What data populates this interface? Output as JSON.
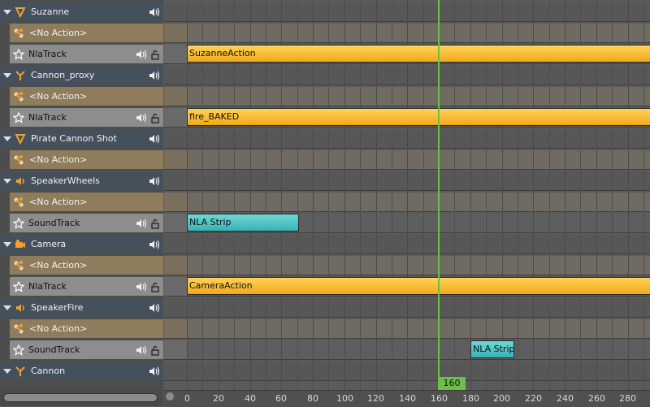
{
  "channels": [
    {
      "kind": "object",
      "label": "Suzanne",
      "icon": "triangle-down-icon"
    },
    {
      "kind": "action",
      "label": "<No Action>"
    },
    {
      "kind": "track",
      "label": "NlaTrack"
    },
    {
      "kind": "object",
      "label": "Cannon_proxy",
      "icon": "armature-icon"
    },
    {
      "kind": "action",
      "label": "<No Action>"
    },
    {
      "kind": "track",
      "label": "NlaTrack"
    },
    {
      "kind": "object",
      "label": "Pirate Cannon Shot",
      "icon": "triangle-down-icon"
    },
    {
      "kind": "action",
      "label": "<No Action>"
    },
    {
      "kind": "object",
      "label": "SpeakerWheels",
      "icon": "speaker-icon"
    },
    {
      "kind": "action",
      "label": "<No Action>"
    },
    {
      "kind": "track",
      "label": "SoundTrack"
    },
    {
      "kind": "object",
      "label": "Camera",
      "icon": "camera-icon"
    },
    {
      "kind": "action",
      "label": "<No Action>"
    },
    {
      "kind": "track",
      "label": "NlaTrack"
    },
    {
      "kind": "object",
      "label": "SpeakerFire",
      "icon": "speaker-icon"
    },
    {
      "kind": "action",
      "label": "<No Action>"
    },
    {
      "kind": "track",
      "label": "SoundTrack"
    },
    {
      "kind": "object",
      "label": "Cannon",
      "icon": "armature-icon"
    }
  ],
  "strips": [
    {
      "row": 2,
      "type": "action",
      "label": "SuzanneAction",
      "start": 0,
      "end": 300
    },
    {
      "row": 5,
      "type": "action",
      "label": "fire_BAKED",
      "start": 0,
      "end": 300
    },
    {
      "row": 10,
      "type": "sound",
      "label": "NLA Strip",
      "start": 0,
      "end": 71
    },
    {
      "row": 13,
      "type": "action",
      "label": "CameraAction",
      "start": 0,
      "end": 300
    },
    {
      "row": 16,
      "type": "sound",
      "label": "NLA Strip",
      "start": 180,
      "end": 208
    }
  ],
  "playhead": {
    "frame": 160,
    "label": "160",
    "color": "#6cc04a"
  },
  "ruler": {
    "ticks": [
      "0",
      "20",
      "40",
      "60",
      "80",
      "100",
      "120",
      "140",
      "160",
      "180",
      "200",
      "220",
      "240",
      "260",
      "280"
    ]
  },
  "colors": {
    "action_strip": "#f3a919",
    "sound_strip": "#39b2b3",
    "object_row": "#44505c",
    "action_row": "#8e7c5c",
    "track_row": "#8d8d8d"
  }
}
